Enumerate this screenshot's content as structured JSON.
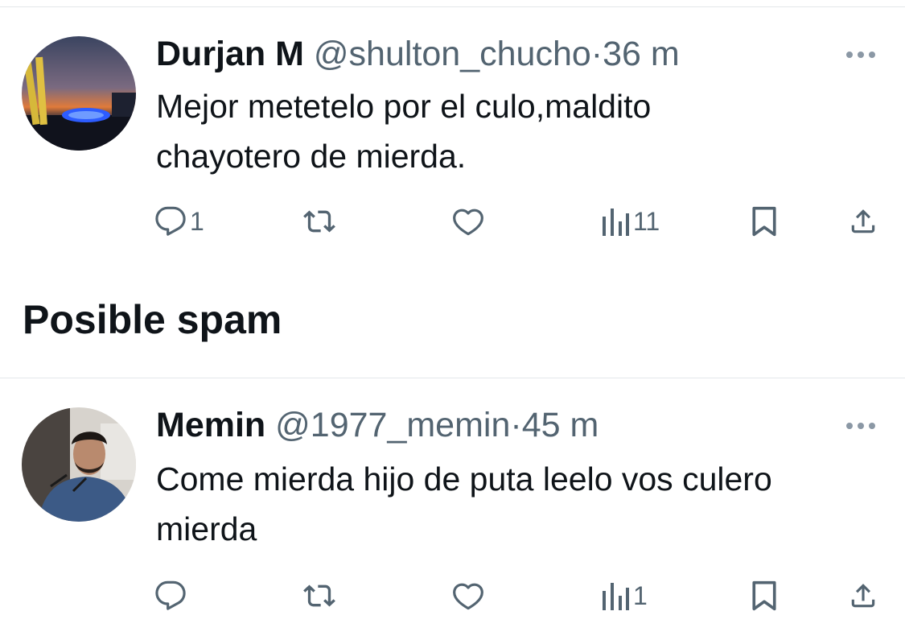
{
  "tweets": [
    {
      "name": "Durjan M",
      "handle": "@shulton_chucho",
      "separator": "·",
      "time": "36 m",
      "text_lines": [
        "Mejor metetelo por el culo,maldito",
        "chayotero de mierda."
      ],
      "reply_count": "1",
      "view_count": "11",
      "avatar_icon": "sunset-waterfront-avatar-icon"
    },
    {
      "name": "Memin",
      "handle": "@1977_memin",
      "separator": "·",
      "time": "45 m",
      "text_lines": [
        "Come mierda hijo de puta leelo vos culero",
        "mierda"
      ],
      "reply_count": "",
      "view_count": "1",
      "avatar_icon": "person-portrait-avatar-icon"
    }
  ],
  "section": {
    "title": "Posible spam"
  },
  "icons": {
    "more": "more-horizontal-icon",
    "reply": "reply-bubble-icon",
    "retweet": "retweet-icon",
    "like": "heart-icon",
    "views": "views-bar-chart-icon",
    "bookmark": "bookmark-icon",
    "share": "share-upload-icon"
  },
  "colors": {
    "text_primary": "#0f1419",
    "text_secondary": "#536471",
    "divider": "#e3e7ea"
  }
}
